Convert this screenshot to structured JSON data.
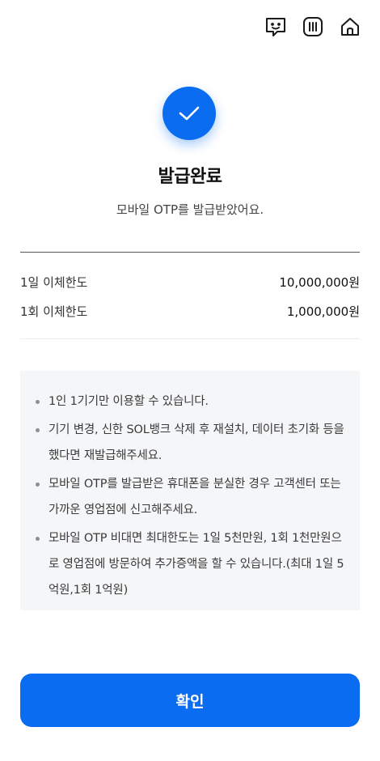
{
  "header": {
    "icons": [
      "chat-face-icon",
      "menu-bars-icon",
      "home-icon"
    ]
  },
  "result": {
    "title": "발급완료",
    "subtitle": "모바일 OTP를 발급받았어요."
  },
  "limits": [
    {
      "label": "1일 이체한도",
      "value": "10,000,000원"
    },
    {
      "label": "1회 이체한도",
      "value": "1,000,000원"
    }
  ],
  "notices": [
    "1인 1기기만 이용할 수 있습니다.",
    "기기 변경, 신한 SOL뱅크 삭제 후 재설치, 데이터 초기화 등을 했다면 재발급해주세요.",
    "모바일 OTP를 발급받은 휴대폰을 분실한 경우 고객센터 또는 가까운 영업점에 신고해주세요.",
    "모바일 OTP 비대면 최대한도는 1일 5천만원, 1회 1천만원으로 영업점에 방문하여 추가증액을 할 수 있습니다.(최대 1일 5억원,1회 1억원)"
  ],
  "confirm_label": "확인",
  "colors": {
    "accent": "#0a6cf0",
    "notice_bg": "#f5f6f8"
  }
}
